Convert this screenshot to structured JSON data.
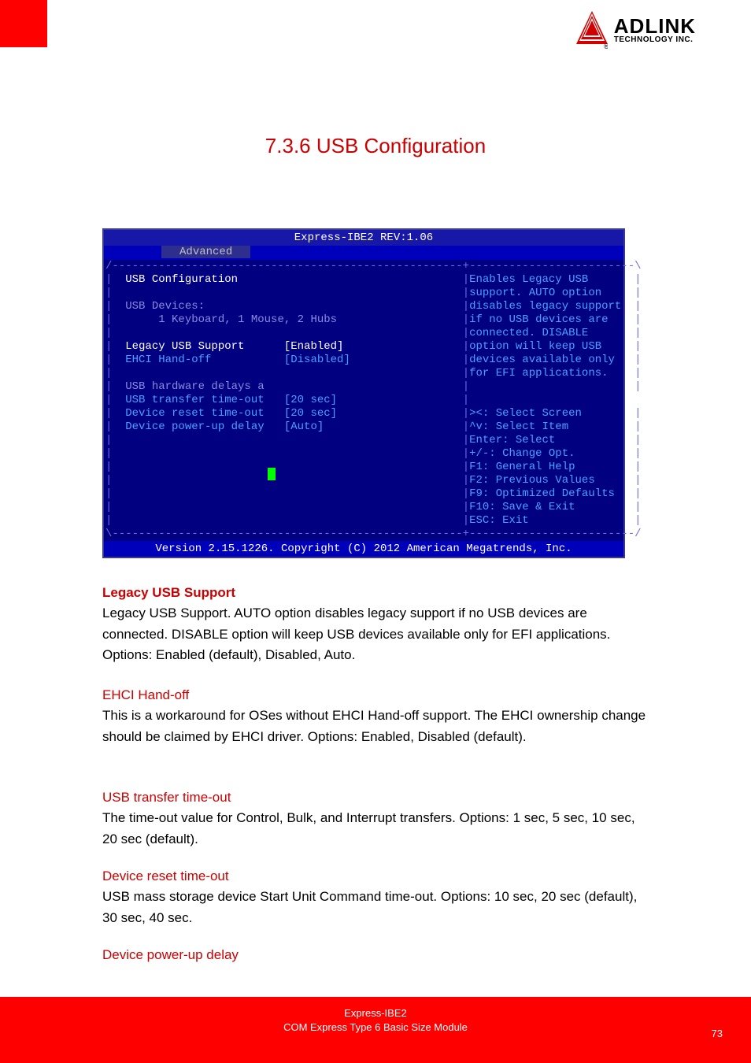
{
  "logo": {
    "brand": "ADLINK",
    "sub": "TECHNOLOGY INC."
  },
  "page_title": "7.3.6 USB Configuration",
  "bios": {
    "title": "Express-IBE2 REV:1.06",
    "tab_left_pad": "        ",
    "tab_active": "  Advanced  ",
    "row_top": "/-----------------------------------------------------+-------------------------\\",
    "row_mid": "|                                                     |-------------------------|",
    "row_bot": "\\-----------------------------------------------------+-------------------------/",
    "lines_left": {
      "l1": "  USB Configuration                                  ",
      "l2": "                                                     ",
      "l3": "  USB Devices:                                       ",
      "l4": "       1 Keyboard, 1 Mouse, 2 Hubs                   ",
      "l5": "                                                     ",
      "l6": "  Legacy USB Support      [Enabled]                  ",
      "l7": "  EHCI Hand-off           [Disabled]                 ",
      "l8": "                                                     ",
      "l9": "  USB hardware delays a                              ",
      "l10": "  USB transfer time-out   [20 sec]                   ",
      "l11": "  Device reset time-out   [20 sec]                   ",
      "l12": "  Device power-up delay   [Auto]                     ",
      "l13": "                                                     ",
      "l14": "                                                     ",
      "l15": "                                                     ",
      "l16": "                                                     ",
      "l17": "                                                     ",
      "l18": "                                                     ",
      "l19": "                                                     "
    },
    "lines_right": {
      "r1": "Enables Legacy USB       ",
      "r2": "support. AUTO option     ",
      "r3": "disables legacy support  ",
      "r4": "if no USB devices are    ",
      "r5": "connected. DISABLE       ",
      "r6": "option will keep USB     ",
      "r7": "devices available only   ",
      "r8": "for EFI applications.    ",
      "r9": "                         ",
      "r11": "><: Select Screen        ",
      "r12": "^v: Select Item          ",
      "r13": "Enter: Select            ",
      "r14": "+/-: Change Opt.         ",
      "r15": "F1: General Help         ",
      "r16": "F2: Previous Values      ",
      "r17": "F9: Optimized Defaults   ",
      "r18": "F10: Save & Exit         ",
      "r19": "ESC: Exit                "
    },
    "footer": "Version 2.15.1226. Copyright (C) 2012 American Megatrends, Inc."
  },
  "sections": {
    "s1_head": "Legacy USB Support",
    "s1_body": "Legacy USB Support. AUTO option disables legacy support if no USB devices are connected. DISABLE option will keep USB devices available only for EFI applications. Options: Enabled (default), Disabled, Auto.",
    "s2_head": "EHCI Hand-off",
    "s2_body": "This is a workaround for OSes without EHCI Hand-off support. The EHCI ownership change should be claimed by EHCI driver. Options: Enabled, Disabled (default).",
    "s3_head": "USB transfer time-out",
    "s3_body": "The time-out value for Control, Bulk, and Interrupt transfers. Options: 1 sec, 5 sec, 10 sec, 20 sec (default).",
    "s4_head": "Device reset time-out",
    "s4_body": "USB mass storage device Start Unit Command time-out. Options: 10 sec, 20 sec (default), 30 sec, 40 sec.",
    "s5_head": "Device power-up delay"
  },
  "footer": {
    "doc": "Express-IBE2",
    "line": "COM Express Type 6 Basic Size Module",
    "page": "73"
  }
}
